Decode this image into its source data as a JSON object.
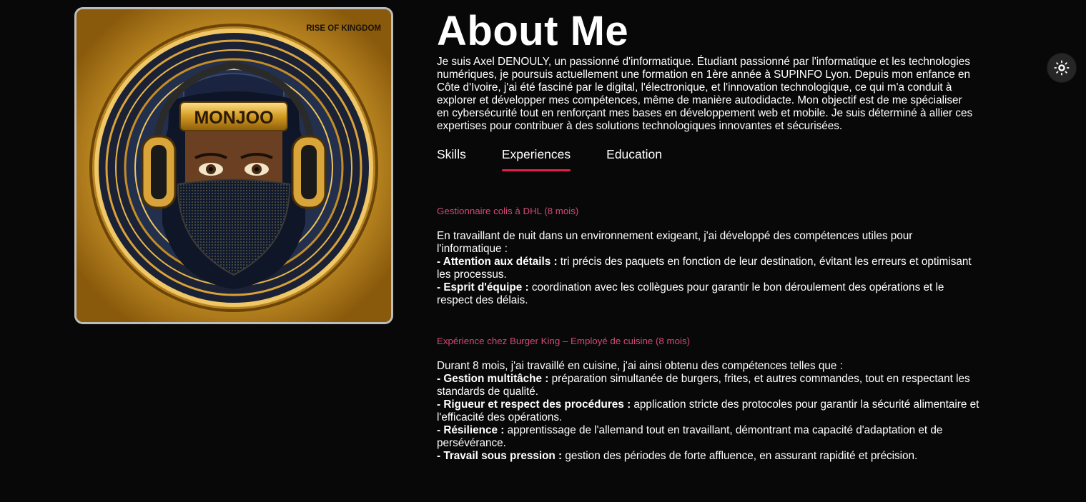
{
  "avatar": {
    "badge_text": "MONJOO",
    "corner_text": "RISE OF KINGDOM"
  },
  "about": {
    "title": "About Me",
    "intro": "Je suis Axel DENOULY, un passionné d'informatique. Étudiant passionné par l'informatique et les technologies numériques, je poursuis actuellement une formation en 1ère année à SUPINFO Lyon. Depuis mon enfance en Côte d'Ivoire, j'ai été fasciné par le digital, l'électronique, et l'innovation technologique, ce qui m'a conduit à explorer et développer mes compétences, même de manière autodidacte. Mon objectif est de me spécialiser en cybersécurité tout en renforçant mes bases en développement web et mobile. Je suis déterminé à allier ces expertises pour contribuer à des solutions technologiques innovantes et sécurisées."
  },
  "tabs": [
    {
      "label": "Skills",
      "active": false
    },
    {
      "label": "Experiences",
      "active": true
    },
    {
      "label": "Education",
      "active": false
    }
  ],
  "experiences": [
    {
      "title": "Gestionnaire colis à DHL (8 mois)",
      "intro": "En travaillant de nuit dans un environnement exigeant, j'ai développé des compétences utiles pour l'informatique :",
      "points": [
        {
          "label": "- Attention aux détails :",
          "text": " tri précis des paquets en fonction de leur destination, évitant les erreurs et optimisant les processus."
        },
        {
          "label": "- Esprit d'équipe :",
          "text": " coordination avec les collègues pour garantir le bon déroulement des opérations et le respect des délais."
        }
      ]
    },
    {
      "title": "Expérience chez Burger King – Employé de cuisine (8 mois)",
      "intro": "Durant 8 mois, j'ai travaillé en cuisine, j'ai ainsi obtenu des compétences telles que :",
      "points": [
        {
          "label": "- Gestion multitâche :",
          "text": " préparation simultanée de burgers, frites, et autres commandes, tout en respectant les standards de qualité."
        },
        {
          "label": "- Rigueur et respect des procédures :",
          "text": " application stricte des protocoles pour garantir la sécurité alimentaire et l'efficacité des opérations."
        },
        {
          "label": "- Résilience :",
          "text": " apprentissage de l'allemand tout en travaillant, démontrant ma capacité d'adaptation et de persévérance."
        },
        {
          "label": "- Travail sous pression :",
          "text": " gestion des périodes de forte affluence, en assurant rapidité et précision."
        }
      ]
    }
  ],
  "theme_toggle": {
    "icon": "sun-icon"
  },
  "colors": {
    "background": "#080808",
    "accent": "#e0204a",
    "experience_title": "#d3497a",
    "text": "#ffffff"
  }
}
